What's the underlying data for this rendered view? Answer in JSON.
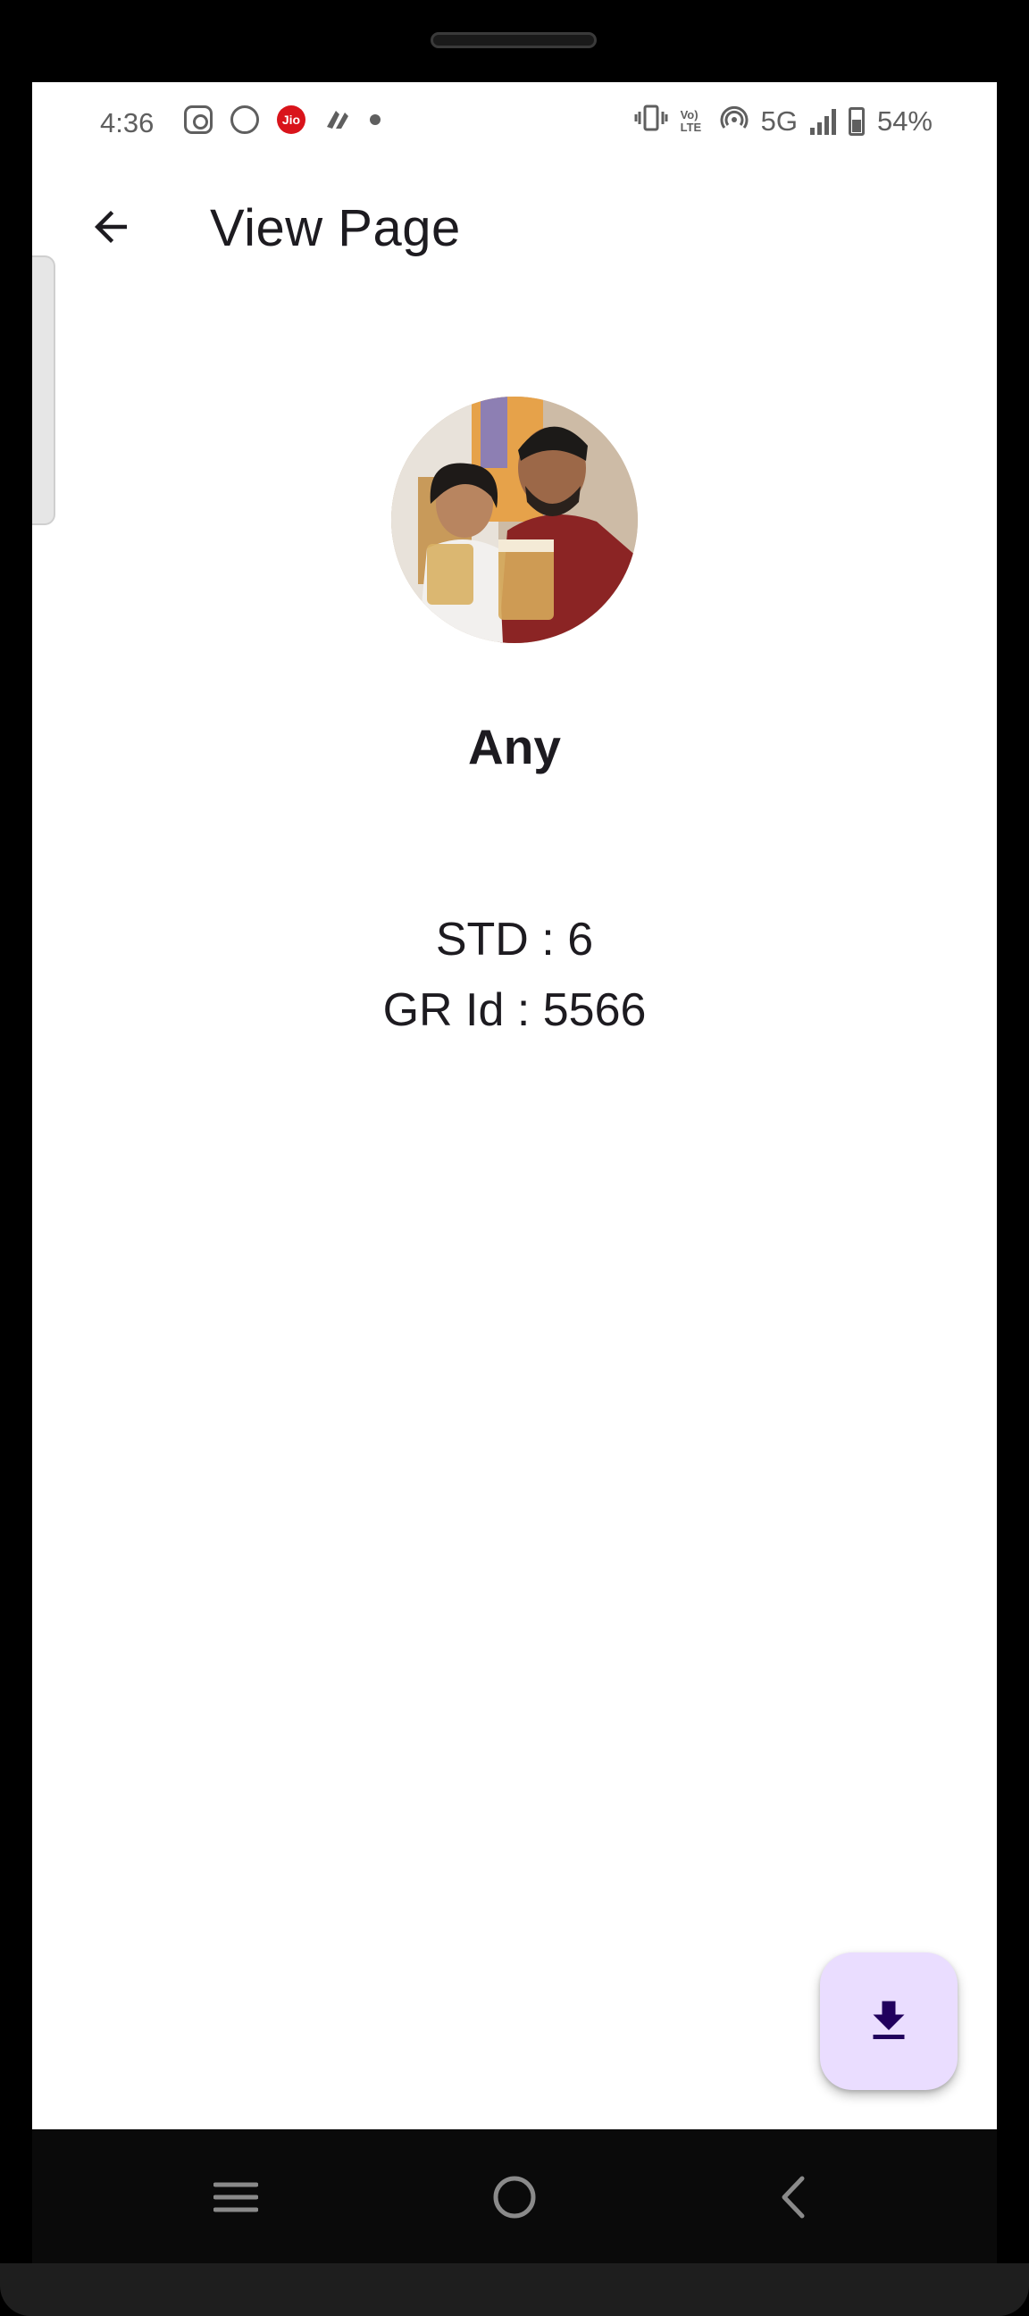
{
  "status_bar": {
    "time": "4:36",
    "network": "5G",
    "volte": "Vo) LTE",
    "battery": "54%",
    "icons_left": [
      "instagram-icon",
      "face-icon",
      "jio-icon",
      "app-icon",
      "dot-icon"
    ],
    "jio_label": "Jio"
  },
  "app_bar": {
    "title": "View Page",
    "back_icon": "arrow-left-icon"
  },
  "profile": {
    "name": "Any",
    "std_line": "STD : 6",
    "gr_line": "GR Id : 5566"
  },
  "fab": {
    "icon": "download-icon"
  },
  "nav": {
    "recent_icon": "menu-lines-icon",
    "home_icon": "home-circle-icon",
    "back_icon": "chevron-left-icon"
  },
  "colors": {
    "fab_bg": "#eaddff",
    "fab_icon": "#21005d",
    "text": "#1d1b20",
    "status_text": "#5f5f5f",
    "jio_red": "#d9141b"
  }
}
